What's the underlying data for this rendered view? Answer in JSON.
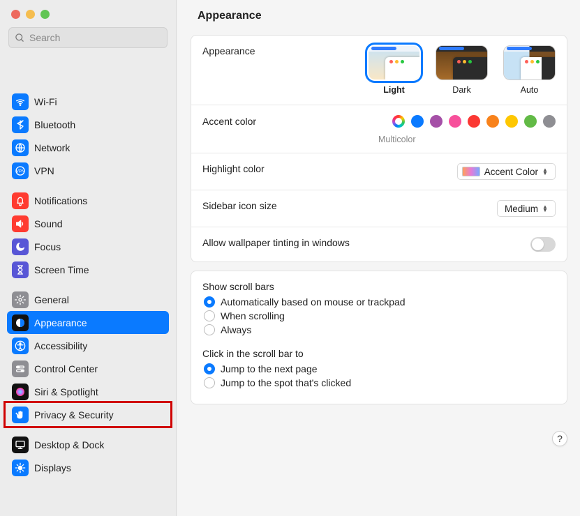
{
  "window": {
    "title": "Appearance"
  },
  "search": {
    "placeholder": "Search"
  },
  "sidebar": {
    "groups": [
      {
        "items": [
          {
            "key": "wifi",
            "label": "Wi-Fi",
            "icon": "wifi",
            "icon_bg": "#0a7aff",
            "icon_fg": "#ffffff"
          },
          {
            "key": "bluetooth",
            "label": "Bluetooth",
            "icon": "bluetooth",
            "icon_bg": "#0a7aff",
            "icon_fg": "#ffffff"
          },
          {
            "key": "network",
            "label": "Network",
            "icon": "globe",
            "icon_bg": "#0a7aff",
            "icon_fg": "#ffffff"
          },
          {
            "key": "vpn",
            "label": "VPN",
            "icon": "vpn",
            "icon_bg": "#0a7aff",
            "icon_fg": "#ffffff"
          }
        ]
      },
      {
        "items": [
          {
            "key": "notifications",
            "label": "Notifications",
            "icon": "bell",
            "icon_bg": "#ff3b30",
            "icon_fg": "#ffffff"
          },
          {
            "key": "sound",
            "label": "Sound",
            "icon": "speaker",
            "icon_bg": "#ff3b30",
            "icon_fg": "#ffffff"
          },
          {
            "key": "focus",
            "label": "Focus",
            "icon": "moon",
            "icon_bg": "#5856d6",
            "icon_fg": "#ffffff"
          },
          {
            "key": "screentime",
            "label": "Screen Time",
            "icon": "hourglass",
            "icon_bg": "#5856d6",
            "icon_fg": "#ffffff"
          }
        ]
      },
      {
        "items": [
          {
            "key": "general",
            "label": "General",
            "icon": "gear",
            "icon_bg": "#8e8e93",
            "icon_fg": "#ffffff"
          },
          {
            "key": "appearance",
            "label": "Appearance",
            "icon": "appearance",
            "icon_bg": "#111111",
            "icon_fg": "#ffffff",
            "selected": true
          },
          {
            "key": "accessibility",
            "label": "Accessibility",
            "icon": "accessibility",
            "icon_bg": "#0a7aff",
            "icon_fg": "#ffffff"
          },
          {
            "key": "controlcenter",
            "label": "Control Center",
            "icon": "switches",
            "icon_bg": "#8e8e93",
            "icon_fg": "#ffffff"
          },
          {
            "key": "siri",
            "label": "Siri & Spotlight",
            "icon": "siri",
            "icon_bg": "#111111",
            "icon_fg": "#ffffff"
          },
          {
            "key": "privacy",
            "label": "Privacy & Security",
            "icon": "hand",
            "icon_bg": "#0a7aff",
            "icon_fg": "#ffffff",
            "highlighted": true
          }
        ]
      },
      {
        "items": [
          {
            "key": "desktopdock",
            "label": "Desktop & Dock",
            "icon": "desktop",
            "icon_bg": "#111111",
            "icon_fg": "#ffffff"
          },
          {
            "key": "displays",
            "label": "Displays",
            "icon": "sun",
            "icon_bg": "#0a7aff",
            "icon_fg": "#ffffff"
          }
        ]
      }
    ]
  },
  "appearance": {
    "section_label": "Appearance",
    "options": [
      {
        "key": "light",
        "label": "Light",
        "selected": true
      },
      {
        "key": "dark",
        "label": "Dark",
        "selected": false
      },
      {
        "key": "auto",
        "label": "Auto",
        "selected": false
      }
    ],
    "accent_label": "Accent color",
    "accent_selected_caption": "Multicolor",
    "accent_colors": [
      {
        "key": "multicolor",
        "color": "conic"
      },
      {
        "key": "blue",
        "color": "#0a7aff"
      },
      {
        "key": "purple",
        "color": "#a550a7"
      },
      {
        "key": "pink",
        "color": "#f7509b"
      },
      {
        "key": "red",
        "color": "#fb3833"
      },
      {
        "key": "orange",
        "color": "#f8821b"
      },
      {
        "key": "yellow",
        "color": "#fec701"
      },
      {
        "key": "green",
        "color": "#62ba46"
      },
      {
        "key": "graphite",
        "color": "#8e8e93"
      }
    ],
    "highlight_label": "Highlight color",
    "highlight_value": "Accent Color",
    "sidebar_size_label": "Sidebar icon size",
    "sidebar_size_value": "Medium",
    "wallpaper_tint_label": "Allow wallpaper tinting in windows",
    "wallpaper_tint_on": false,
    "scroll_bars_title": "Show scroll bars",
    "scroll_bars_options": [
      {
        "key": "auto",
        "label": "Automatically based on mouse or trackpad",
        "checked": true
      },
      {
        "key": "scrolling",
        "label": "When scrolling",
        "checked": false
      },
      {
        "key": "always",
        "label": "Always",
        "checked": false
      }
    ],
    "scroll_click_title": "Click in the scroll bar to",
    "scroll_click_options": [
      {
        "key": "next",
        "label": "Jump to the next page",
        "checked": true
      },
      {
        "key": "spot",
        "label": "Jump to the spot that's clicked",
        "checked": false
      }
    ]
  },
  "help_label": "?"
}
